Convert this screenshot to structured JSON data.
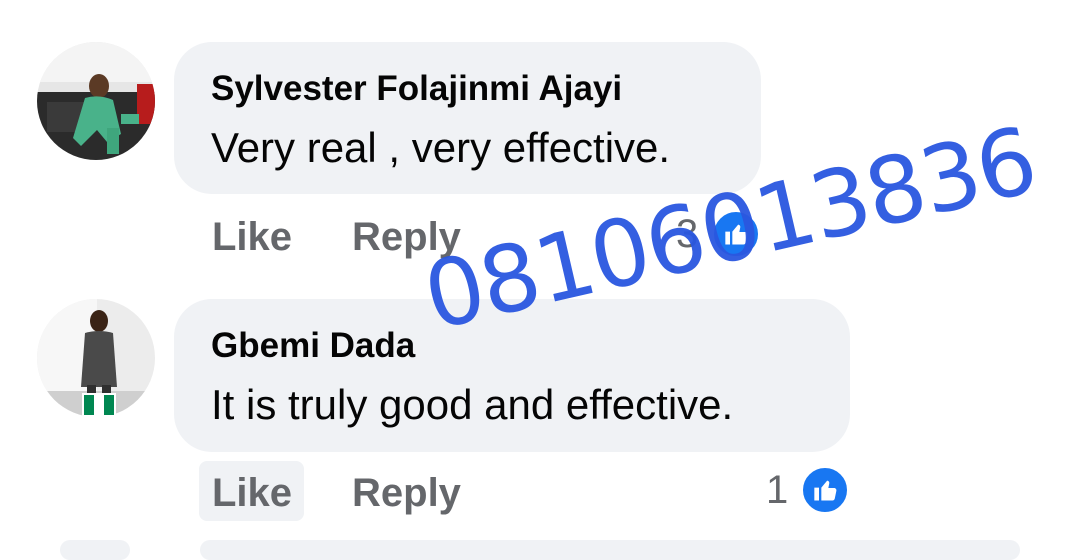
{
  "comments": [
    {
      "author": "Sylvester Folajinmi Ajayi",
      "text": "Very real , very effective.",
      "like_label": "Like",
      "reply_label": "Reply",
      "reaction_count": "3",
      "reaction_icon": "thumbs-up-icon"
    },
    {
      "author": "Gbemi Dada",
      "text": "It is truly good and effective.",
      "like_label": "Like",
      "reply_label": "Reply",
      "reaction_count": "1",
      "reaction_icon": "thumbs-up-icon",
      "avatar_badge": "nigeria-flag-icon"
    }
  ],
  "watermark": "08106013836",
  "colors": {
    "bubble": "#f0f2f5",
    "action_text": "#65676b",
    "like_blue": "#1877f2",
    "watermark": "#2a57e0",
    "flag_green": "#008751",
    "flag_white": "#ffffff"
  }
}
